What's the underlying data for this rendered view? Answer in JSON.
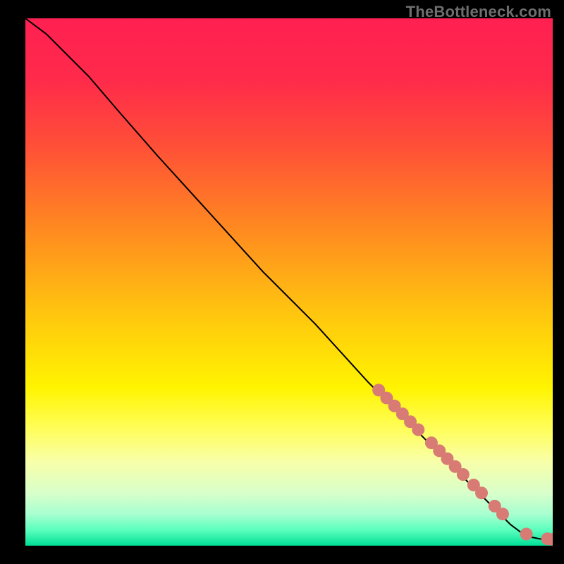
{
  "watermark": "TheBottleneck.com",
  "chart_data": {
    "type": "line",
    "title": "",
    "xlabel": "",
    "ylabel": "",
    "xlim": [
      0,
      100
    ],
    "ylim": [
      0,
      100
    ],
    "background_gradient_stops": [
      {
        "offset": 0.0,
        "color": "#ff2052"
      },
      {
        "offset": 0.12,
        "color": "#ff2b4a"
      },
      {
        "offset": 0.25,
        "color": "#ff5236"
      },
      {
        "offset": 0.4,
        "color": "#ff8a20"
      },
      {
        "offset": 0.55,
        "color": "#ffc210"
      },
      {
        "offset": 0.7,
        "color": "#fff400"
      },
      {
        "offset": 0.78,
        "color": "#fffe5c"
      },
      {
        "offset": 0.84,
        "color": "#f8ffa8"
      },
      {
        "offset": 0.9,
        "color": "#d8ffca"
      },
      {
        "offset": 0.94,
        "color": "#a8ffd0"
      },
      {
        "offset": 0.97,
        "color": "#5cffbe"
      },
      {
        "offset": 1.0,
        "color": "#00e096"
      }
    ],
    "series": [
      {
        "name": "curve",
        "color": "#000000",
        "x": [
          0,
          4,
          8,
          12,
          18,
          25,
          35,
          45,
          55,
          65,
          72,
          78,
          84,
          89,
          92,
          94,
          96,
          98,
          100
        ],
        "y": [
          100,
          97,
          93,
          89,
          82,
          74,
          63,
          52,
          42,
          31,
          24,
          18,
          12,
          7,
          4,
          2.5,
          1.6,
          1.2,
          1.2
        ]
      }
    ],
    "markers": {
      "name": "bottleneck-points",
      "color": "#d87b74",
      "radius": 9,
      "x": [
        67,
        68.5,
        70,
        71.5,
        73,
        74.5,
        77,
        78.5,
        80,
        81.5,
        83,
        85,
        86.5,
        89,
        90.5,
        95,
        99,
        100
      ],
      "y": [
        29.5,
        28,
        26.5,
        25,
        23.5,
        22,
        19.5,
        18,
        16.5,
        15,
        13.5,
        11.5,
        10,
        7.5,
        6,
        2.2,
        1.3,
        1.2
      ]
    }
  }
}
